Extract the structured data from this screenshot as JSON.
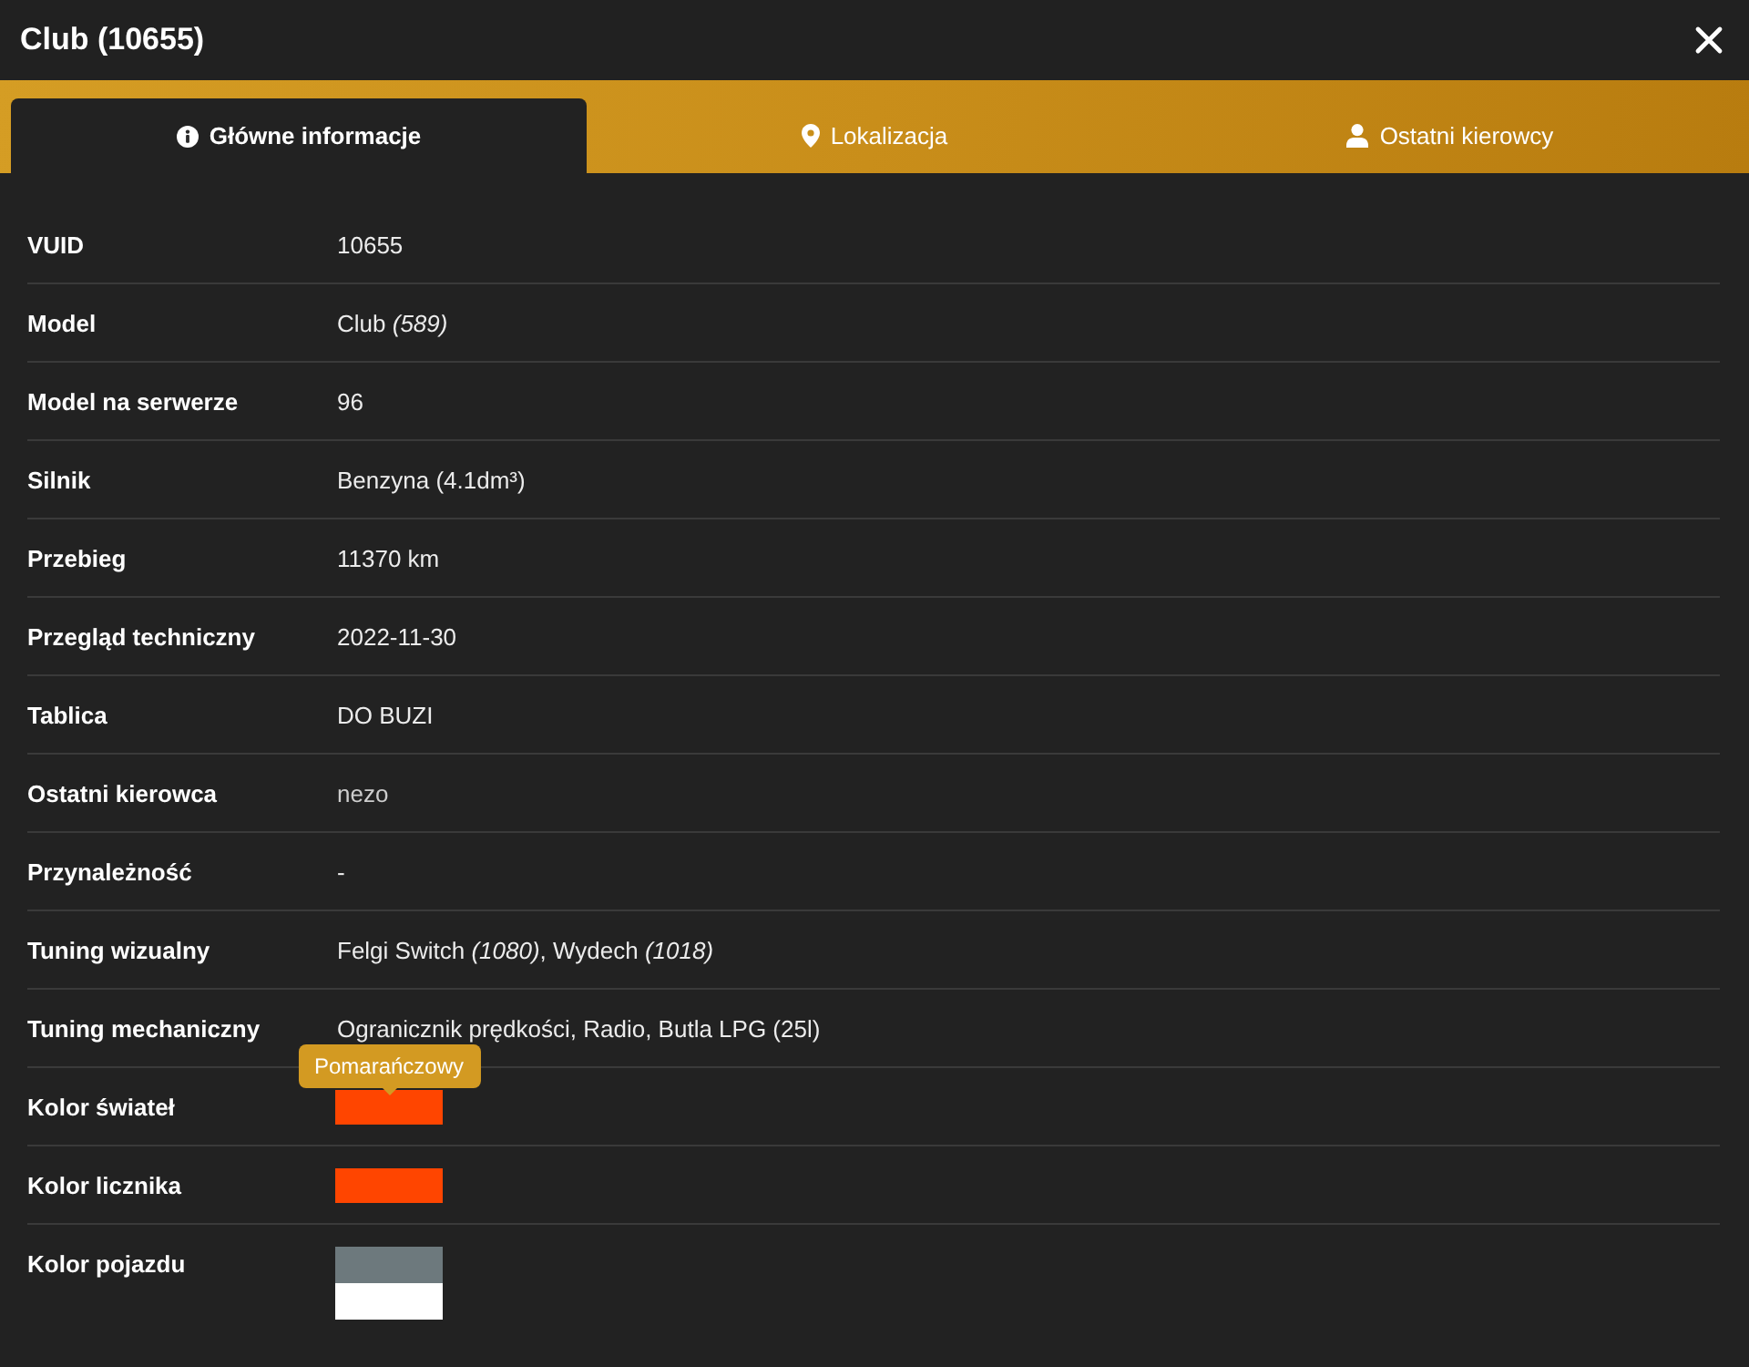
{
  "window": {
    "title": "Club (10655)"
  },
  "tabs": [
    {
      "label": "Główne informacje",
      "selected": true
    },
    {
      "label": "Lokalizacja",
      "selected": false
    },
    {
      "label": "Ostatni kierowcy",
      "selected": false
    }
  ],
  "rows": [
    {
      "kind": "text",
      "label": "VUID",
      "value": "10655"
    },
    {
      "kind": "text",
      "label": "Model",
      "value": "Club *(589)*"
    },
    {
      "kind": "text",
      "label": "Model na serwerze",
      "value": "96"
    },
    {
      "kind": "text",
      "label": "Silnik",
      "value": "Benzyna (4.1dm³)"
    },
    {
      "kind": "text",
      "label": "Przebieg",
      "value": "11370 km"
    },
    {
      "kind": "text",
      "label": "Przegląd techniczny",
      "value": "2022-11-30"
    },
    {
      "kind": "text",
      "label": "Tablica",
      "value": "DO BUZI"
    },
    {
      "kind": "link",
      "label": "Ostatni kierowca",
      "value": "nezo"
    },
    {
      "kind": "text",
      "label": "Przynależność",
      "value": "-"
    },
    {
      "kind": "text",
      "label": "Tuning wizualny",
      "value": "Felgi Switch *(1080)*, Wydech *(1018)*"
    },
    {
      "kind": "text",
      "label": "Tuning mechaniczny",
      "value": "Ogranicznik prędkości, Radio, Butla LPG (25l)"
    },
    {
      "kind": "swatch",
      "label": "Kolor świateł",
      "color": "#ff4500",
      "tooltip": "Pomarańczowy"
    },
    {
      "kind": "swatch",
      "label": "Kolor licznika",
      "color": "#ff4500"
    },
    {
      "kind": "swatch-stack",
      "label": "Kolor pojazdu",
      "swatches": [
        {
          "color": "#6d797d"
        },
        {
          "color": "#ffffff"
        }
      ]
    }
  ]
}
